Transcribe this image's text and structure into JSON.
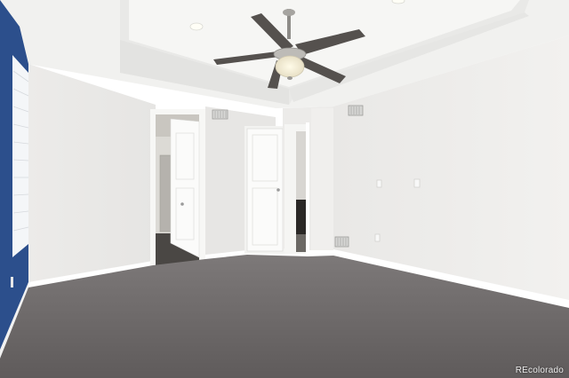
{
  "photo": {
    "subject": "empty-bedroom",
    "watermark": "REcolorado"
  },
  "colors": {
    "accent_wall": "#2c4f8c",
    "wall": "#eeedeb",
    "ceiling": "#f4f4f2",
    "carpet": "#6e6a6a",
    "fan_blade": "#56524f",
    "trim": "#ffffff"
  },
  "icons": {
    "ceiling_fan": "ceiling-fan-icon",
    "vent": "vent-icon",
    "outlet": "outlet-icon",
    "light_switch": "light-switch-icon",
    "recessed_light": "recessed-light-icon"
  }
}
